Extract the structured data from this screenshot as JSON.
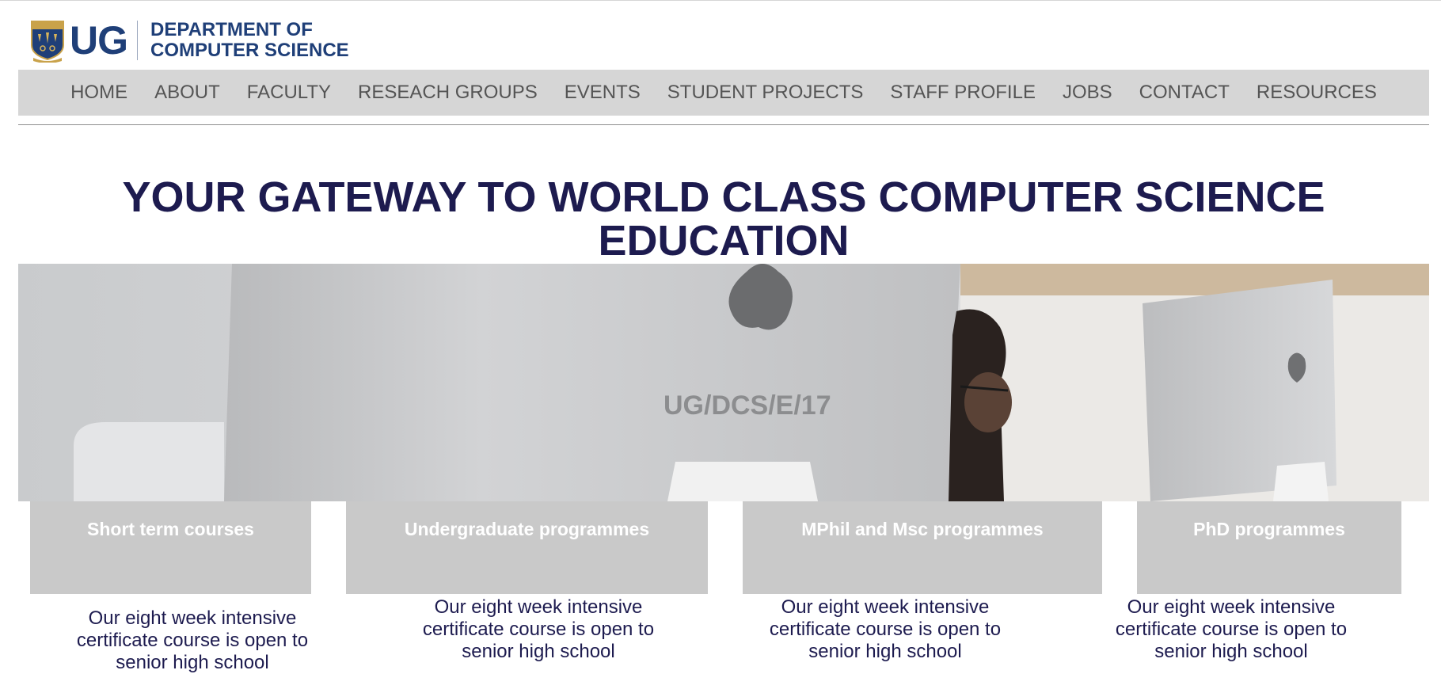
{
  "header": {
    "logo_abbrev": "UG",
    "department_line1": "DEPARTMENT OF",
    "department_line2": "COMPUTER SCIENCE"
  },
  "nav": {
    "items": [
      "HOME",
      "ABOUT",
      "FACULTY",
      "RESEACH GROUPS",
      "EVENTS",
      "STUDENT PROJECTS",
      "STAFF PROFILE",
      "JOBS",
      "CONTACT",
      "RESOURCES"
    ]
  },
  "hero": {
    "title": "YOUR GATEWAY TO WORLD CLASS COMPUTER SCIENCE EDUCATION",
    "image_text": "UG/DCS/E/17"
  },
  "programmes": [
    {
      "label": "Short term courses",
      "description": "Our eight week intensive certificate course is open to senior high school"
    },
    {
      "label": "Undergraduate programmes",
      "description": "Our eight week intensive certificate course is open to senior high school"
    },
    {
      "label": "MPhil and Msc programmes",
      "description": "Our eight week intensive certificate course is open to senior high school"
    },
    {
      "label": "PhD programmes",
      "description": "Our eight week intensive certificate course is open to senior high school"
    }
  ],
  "colors": {
    "brand_blue": "#1f3f78",
    "title_navy": "#1d1b4f",
    "nav_bg": "#d6d6d6",
    "card_bg": "#c9c9c9"
  },
  "icons": {
    "crest": "university-crest-icon"
  }
}
